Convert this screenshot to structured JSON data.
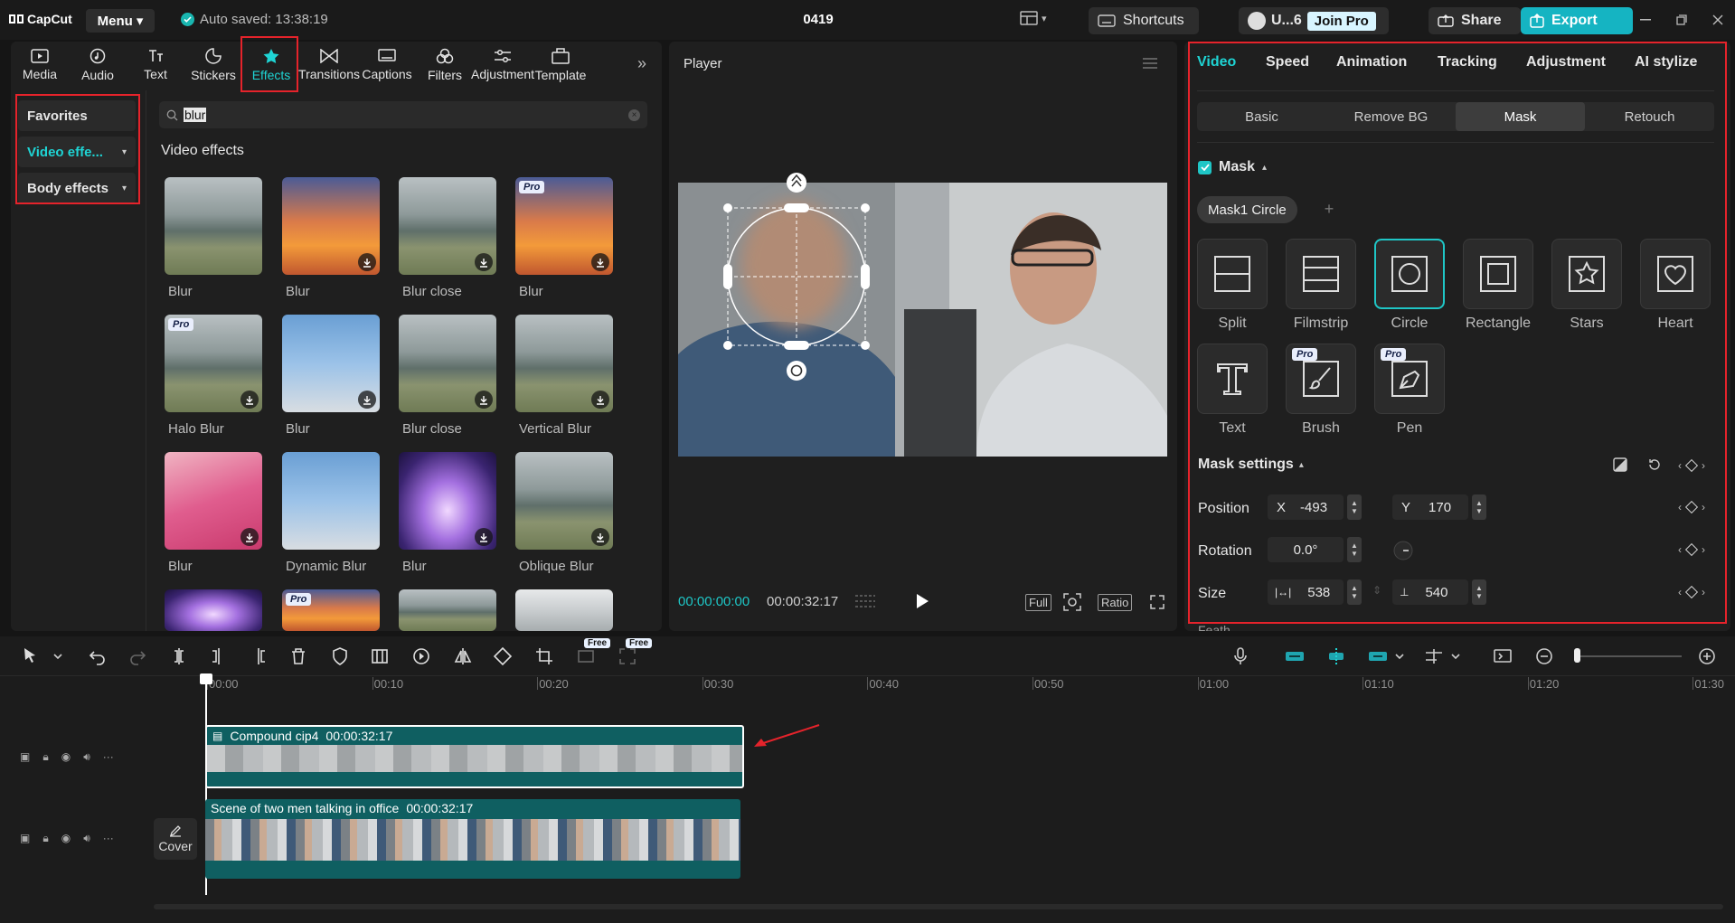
{
  "app": {
    "logo": "CapCut",
    "menu_label": "Menu",
    "autosave": "Auto saved: 13:38:19",
    "project_title": "0419",
    "shortcuts": "Shortcuts",
    "user": "U...6",
    "join_pro": "Join Pro",
    "share": "Share",
    "export": "Export"
  },
  "tools": [
    {
      "label": "Media",
      "icon": "media-icon"
    },
    {
      "label": "Audio",
      "icon": "audio-icon"
    },
    {
      "label": "Text",
      "icon": "text-icon"
    },
    {
      "label": "Stickers",
      "icon": "stickers-icon"
    },
    {
      "label": "Effects",
      "icon": "effects-icon",
      "active": true
    },
    {
      "label": "Transitions",
      "icon": "transitions-icon"
    },
    {
      "label": "Captions",
      "icon": "captions-icon"
    },
    {
      "label": "Filters",
      "icon": "filters-icon"
    },
    {
      "label": "Adjustment",
      "icon": "adjustment-icon"
    },
    {
      "label": "Template",
      "icon": "template-icon"
    }
  ],
  "sidebar": {
    "favorites": "Favorites",
    "video_effects": "Video effe...",
    "body_effects": "Body effects"
  },
  "search": {
    "value": "blur"
  },
  "effects": {
    "section_title": "Video effects",
    "items": [
      {
        "label": "Blur",
        "pro": false,
        "download": false,
        "style": "forest"
      },
      {
        "label": "Blur",
        "pro": false,
        "download": true,
        "style": "sunset"
      },
      {
        "label": "Blur close",
        "pro": false,
        "download": true,
        "style": "forest"
      },
      {
        "label": "Blur",
        "pro": true,
        "download": true,
        "style": "sunset"
      },
      {
        "label": "Halo Blur",
        "pro": true,
        "download": true,
        "style": "forest"
      },
      {
        "label": "Blur",
        "pro": false,
        "download": true,
        "style": "sky"
      },
      {
        "label": "Blur close",
        "pro": false,
        "download": true,
        "style": "forest"
      },
      {
        "label": "Vertical Blur",
        "pro": false,
        "download": true,
        "style": "forest"
      },
      {
        "label": "Blur",
        "pro": false,
        "download": true,
        "style": "pink"
      },
      {
        "label": "Dynamic Blur",
        "pro": false,
        "download": false,
        "style": "sky"
      },
      {
        "label": "Blur",
        "pro": false,
        "download": true,
        "style": "purple"
      },
      {
        "label": "Oblique Blur",
        "pro": false,
        "download": true,
        "style": "forest"
      },
      {
        "label": "",
        "pro": false,
        "download": false,
        "style": "purple"
      },
      {
        "label": "",
        "pro": true,
        "download": false,
        "style": "sunset"
      },
      {
        "label": "",
        "pro": false,
        "download": false,
        "style": "forest"
      },
      {
        "label": "",
        "pro": false,
        "download": false,
        "style": "fog"
      }
    ]
  },
  "player": {
    "title": "Player",
    "current_time": "00:00:00:00",
    "total_time": "00:00:32:17",
    "full": "Full",
    "ratio": "Ratio"
  },
  "inspector": {
    "tabs": [
      "Video",
      "Speed",
      "Animation",
      "Tracking",
      "Adjustment",
      "AI stylize"
    ],
    "subtabs": [
      "Basic",
      "Remove BG",
      "Mask",
      "Retouch"
    ],
    "mask_label": "Mask",
    "mask_chip": "Mask1 Circle",
    "mask_options": [
      {
        "label": "Split",
        "icon": "split-mask-icon"
      },
      {
        "label": "Filmstrip",
        "icon": "filmstrip-mask-icon"
      },
      {
        "label": "Circle",
        "icon": "circle-mask-icon",
        "selected": true
      },
      {
        "label": "Rectangle",
        "icon": "rectangle-mask-icon"
      },
      {
        "label": "Stars",
        "icon": "star-mask-icon"
      },
      {
        "label": "Heart",
        "icon": "heart-mask-icon"
      },
      {
        "label": "Text",
        "icon": "text-mask-icon"
      },
      {
        "label": "Brush",
        "icon": "brush-mask-icon",
        "pro": true
      },
      {
        "label": "Pen",
        "icon": "pen-mask-icon",
        "pro": true
      }
    ],
    "mask_settings": "Mask settings",
    "position_label": "Position",
    "pos_x_label": "X",
    "pos_x": "-493",
    "pos_y_label": "Y",
    "pos_y": "170",
    "rotation_label": "Rotation",
    "rotation": "0.0°",
    "size_label": "Size",
    "size_w": "538",
    "size_h": "540",
    "cut_off_label": "Feath"
  },
  "timeline": {
    "ruler": [
      "00:00",
      "00:10",
      "00:20",
      "00:30",
      "00:40",
      "00:50",
      "01:00",
      "01:10",
      "01:20",
      "01:30"
    ],
    "free": "Free",
    "clip1_name": "Compound cip4",
    "clip1_duration": "00:00:32:17",
    "clip2_name": "Scene of two men talking in office",
    "clip2_duration": "00:00:32:17",
    "cover": "Cover"
  },
  "colors": {
    "accent": "#1fd4d4",
    "highlight": "#e5232b",
    "clip": "#0f5f61"
  }
}
